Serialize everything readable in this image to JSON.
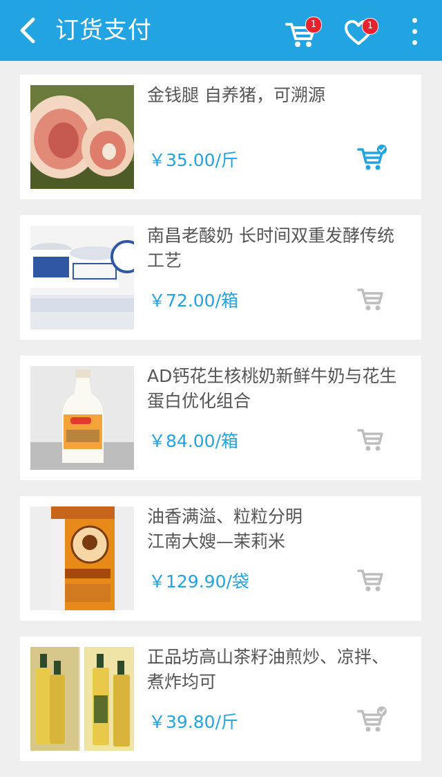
{
  "header": {
    "title": "订货支付",
    "cart_badge": "1",
    "favorites_badge": "1",
    "bg_color": "#22a3e2"
  },
  "products": [
    {
      "name": "金钱腿  自养猪，可溯源",
      "price": "￥35.00/斤",
      "image": "pork-leg",
      "in_cart": true
    },
    {
      "name": "南昌老酸奶  长时间双重发酵传统工艺",
      "price": "￥72.00/箱",
      "image": "yogurt-jars",
      "in_cart": false
    },
    {
      "name": "AD钙花生核桃奶新鲜牛奶与花生蛋白优化组合",
      "price": "￥84.00/箱",
      "image": "milk-bottle",
      "in_cart": false
    },
    {
      "name": "油香满溢、粒粒分明\n江南大嫂—茉莉米",
      "price": "￥129.90/袋",
      "image": "rice-bag",
      "in_cart": false
    },
    {
      "name": "正品坊高山茶籽油煎炒、凉拌、煮炸均可",
      "price": "￥39.80/斤",
      "image": "oil-bottles",
      "in_cart": true
    }
  ],
  "colors": {
    "accent": "#22a3e2",
    "badge": "#e8232f",
    "cart_active": "#22a3e2",
    "cart_inactive": "#bdbdbd"
  }
}
